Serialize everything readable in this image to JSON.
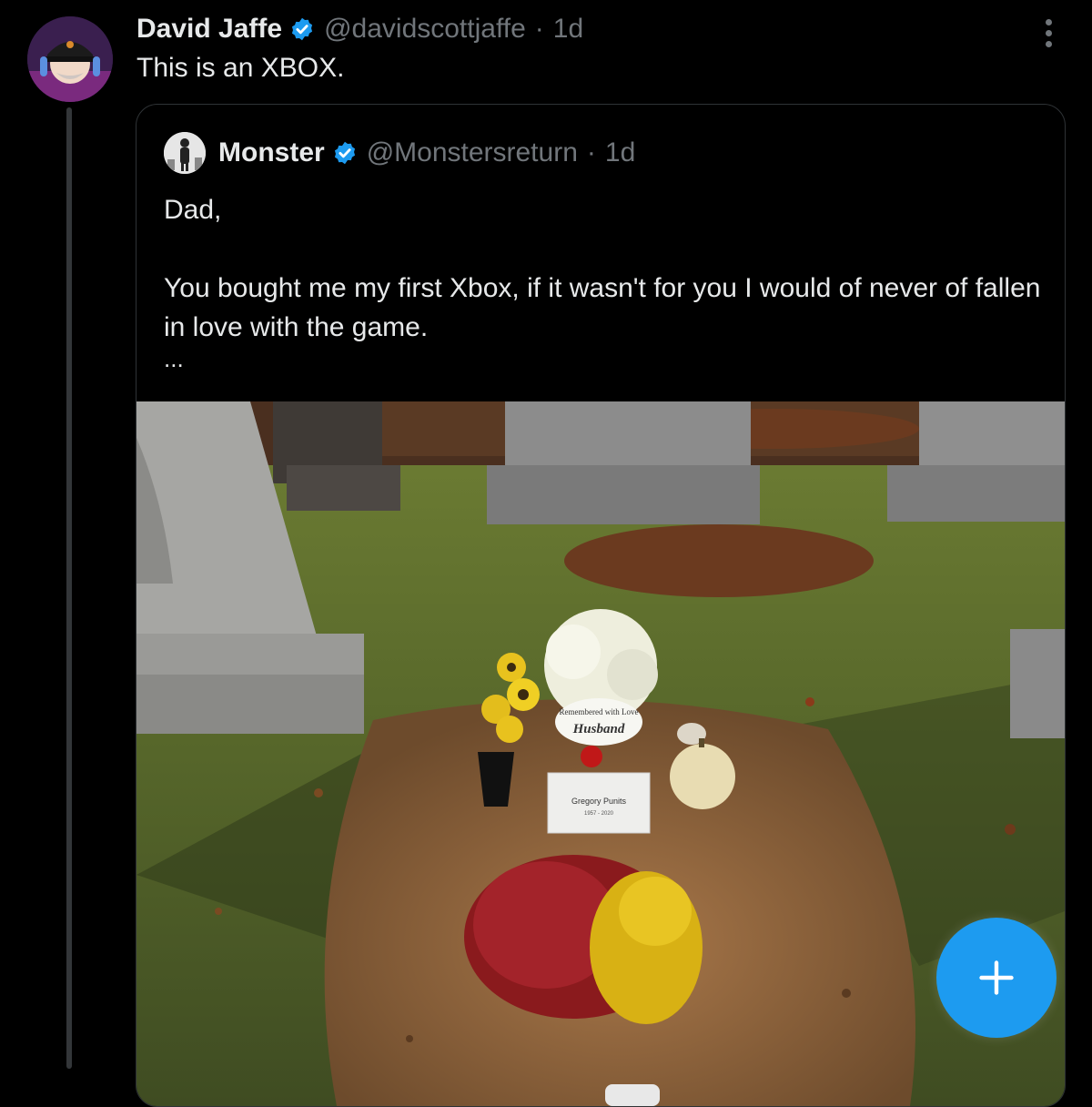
{
  "post": {
    "author_name": "David Jaffe",
    "author_handle": "@davidscottjaffe",
    "separator": "·",
    "time": "1d",
    "text": "This is an XBOX."
  },
  "quoted_post": {
    "author_name": "Monster",
    "author_handle": "@Monstersreturn",
    "separator": "·",
    "time": "1d",
    "text_line_1": "Dad,",
    "text_line_2": "You bought me my first Xbox, if it wasn't for you I would of never of fallen in love with the game.",
    "ellipsis": "...",
    "photo": {
      "card_script": "Remembered with Love",
      "card_word": "Husband",
      "plaque_name": "Gregory Punits",
      "plaque_years": "1957 - 2020"
    }
  },
  "fab": {
    "icon": "plus-icon"
  },
  "colors": {
    "background": "#000000",
    "text": "#e7e9ea",
    "muted": "#71767b",
    "verified": "#1d9bf0",
    "fab": "#1d9bf0"
  }
}
